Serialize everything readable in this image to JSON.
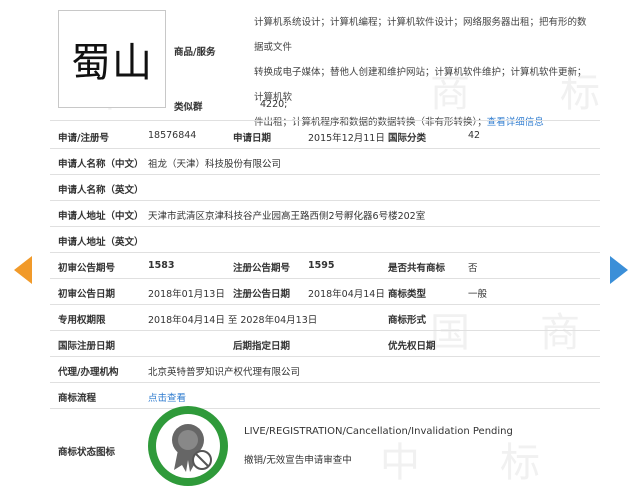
{
  "mark": {
    "text": "蜀山"
  },
  "goods": {
    "label": "商品/服务",
    "lines": [
      "计算机系统设计；计算机编程；计算机软件设计；网络服务器出租；把有形的数据或文件",
      "转换成电子媒体；替他人创建和维护网站；计算机软件维护；计算机软件更新；计算机软",
      "件出租；计算机程序和数据的数据转换（非有形转换）；"
    ],
    "detail_link": "查看详细信息"
  },
  "similar_group": {
    "label": "类似群",
    "value": "4220;"
  },
  "rows": {
    "reg_no": {
      "label": "申请/注册号",
      "value": "18576844"
    },
    "apply_date": {
      "label": "申请日期",
      "value": "2015年12月11日"
    },
    "intl_class": {
      "label": "国际分类",
      "value": "42"
    },
    "applicant_cn": {
      "label": "申请人名称（中文）",
      "value": "祖龙（天津）科技股份有限公司"
    },
    "applicant_en": {
      "label": "申请人名称（英文）",
      "value": ""
    },
    "address_cn": {
      "label": "申请人地址（中文）",
      "value": "天津市武清区京津科技谷产业园高王路西侧2号孵化器6号楼202室"
    },
    "address_en": {
      "label": "申请人地址（英文）",
      "value": ""
    },
    "prelim_no": {
      "label": "初审公告期号",
      "value": "1583"
    },
    "reg_pub_no": {
      "label": "注册公告期号",
      "value": "1595"
    },
    "shared": {
      "label": "是否共有商标",
      "value": "否"
    },
    "prelim_date": {
      "label": "初审公告日期",
      "value": "2018年01月13日"
    },
    "reg_pub_date": {
      "label": "注册公告日期",
      "value": "2018年04月14日"
    },
    "mark_type": {
      "label": "商标类型",
      "value": "一般"
    },
    "exclusive": {
      "label": "专用权期限",
      "value": "2018年04月14日 至 2028年04月13日"
    },
    "mark_form": {
      "label": "商标形式",
      "value": ""
    },
    "intl_reg_date": {
      "label": "国际注册日期",
      "value": ""
    },
    "later_date": {
      "label": "后期指定日期",
      "value": ""
    },
    "priority_date": {
      "label": "优先权日期",
      "value": ""
    },
    "agent": {
      "label": "代理/办理机构",
      "value": "北京英特普罗知识产权代理有限公司"
    },
    "flow": {
      "label": "商标流程",
      "value": "点击查看"
    }
  },
  "status": {
    "label": "商标状态图标",
    "en": "LIVE/REGISTRATION/Cancellation/Invalidation Pending",
    "cn": "撤销/无效宣告申请审查中"
  },
  "watermark": [
    "中",
    "国",
    "商",
    "标"
  ],
  "colors": {
    "arrow_left": "#f19a2a",
    "arrow_right": "#3b8fd8",
    "badge": "#2f9a3a",
    "link": "#2e7bcf"
  },
  "icons": {
    "prev": "chevron-left-icon",
    "next": "chevron-right-icon",
    "status": "award-ribbon-icon"
  }
}
